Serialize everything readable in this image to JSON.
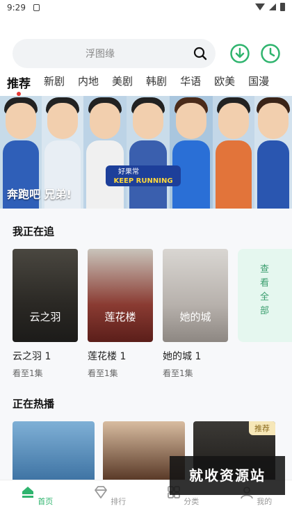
{
  "status": {
    "time": "9:29"
  },
  "search": {
    "placeholder": "浮图缘"
  },
  "tabs": [
    {
      "label": "推荐",
      "active": true
    },
    {
      "label": "新剧"
    },
    {
      "label": "内地"
    },
    {
      "label": "美剧"
    },
    {
      "label": "韩剧"
    },
    {
      "label": "华语"
    },
    {
      "label": "欧美"
    },
    {
      "label": "国漫"
    }
  ],
  "banner": {
    "caption": "奔跑吧 兄弟!",
    "show_logo_text": "KEEP RUNNING",
    "show_logo_top": "好果常"
  },
  "watching": {
    "title": "我正在追",
    "items": [
      {
        "name": "云之羽 1",
        "progress": "看至1集",
        "art": "云之羽"
      },
      {
        "name": "莲花楼 1",
        "progress": "看至1集",
        "art": "莲花楼"
      },
      {
        "name": "她的城 1",
        "progress": "看至1集",
        "art": "她的城"
      }
    ],
    "view_all": "查看全部"
  },
  "hot": {
    "title": "正在热播",
    "badge": "推荐"
  },
  "watermark": "就收资源站",
  "nav": [
    {
      "label": "首页",
      "icon": "home-icon",
      "active": true
    },
    {
      "label": "排行",
      "icon": "ranking-icon"
    },
    {
      "label": "分类",
      "icon": "category-icon"
    },
    {
      "label": "我的",
      "icon": "profile-icon"
    }
  ],
  "colors": {
    "accent": "#2fb46e",
    "tab_dot": "#e53935",
    "view_all_bg": "#e5f7ef"
  }
}
